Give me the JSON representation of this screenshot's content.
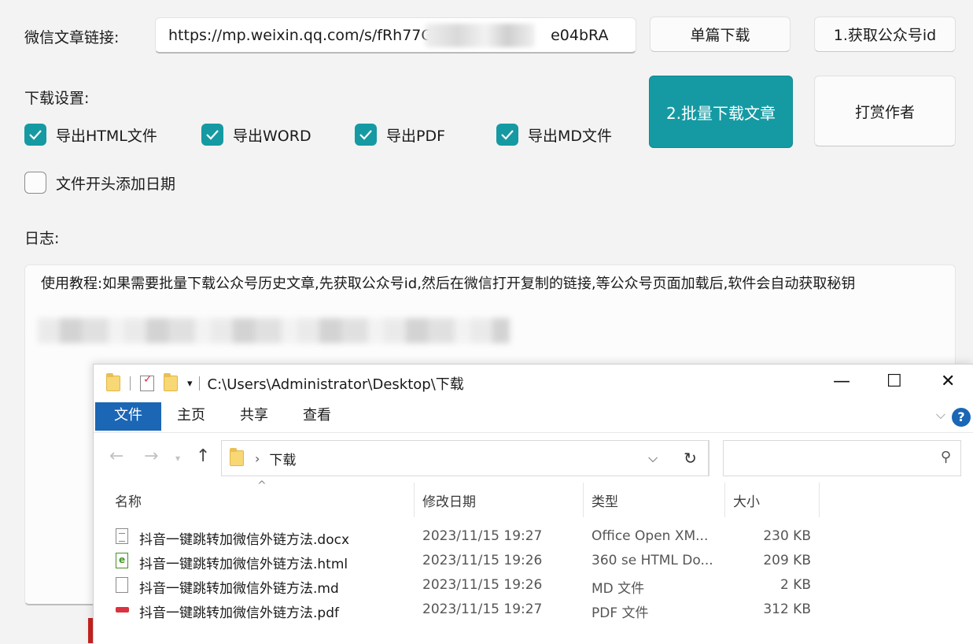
{
  "app": {
    "url_label": "微信文章链接:",
    "url_value": "https://mp.weixin.qq.com/s/fRh77G",
    "url_value_tail": "e04bRA",
    "single_download": "单篇下载",
    "get_account_id": "1.获取公众号id",
    "settings_label": "下载设置:",
    "batch_download": "2.批量下载文章",
    "tip_author": "打赏作者",
    "options": [
      {
        "label": "导出HTML文件",
        "checked": true
      },
      {
        "label": "导出WORD",
        "checked": true
      },
      {
        "label": "导出PDF",
        "checked": true
      },
      {
        "label": "导出MD文件",
        "checked": true
      }
    ],
    "date_prefix": {
      "label": "文件开头添加日期",
      "checked": false
    },
    "log_label": "日志:",
    "log_text": "使用教程:如果需要批量下载公众号历史文章,先获取公众号id,然后在微信打开复制的链接,等公众号页面加载后,软件会自动获取秘钥"
  },
  "explorer": {
    "title": "C:\\Users\\Administrator\\Desktop\\下载",
    "window_controls": {
      "minimize": "—",
      "maximize": "☐",
      "close": "✕"
    },
    "ribbon_tabs": [
      "文件",
      "主页",
      "共享",
      "查看"
    ],
    "breadcrumb": "下载",
    "columns": {
      "name": "名称",
      "modified": "修改日期",
      "type": "类型",
      "size": "大小"
    },
    "files": [
      {
        "name": "抖音一键跳转加微信外链方法.docx",
        "modified": "2023/11/15 19:27",
        "type": "Office Open XM...",
        "size": "230 KB",
        "icon": "doc"
      },
      {
        "name": "抖音一键跳转加微信外链方法.html",
        "modified": "2023/11/15 19:26",
        "type": "360 se HTML Do...",
        "size": "209 KB",
        "icon": "html"
      },
      {
        "name": "抖音一键跳转加微信外链方法.md",
        "modified": "2023/11/15 19:26",
        "type": "MD 文件",
        "size": "2 KB",
        "icon": "md"
      },
      {
        "name": "抖音一键跳转加微信外链方法.pdf",
        "modified": "2023/11/15 19:27",
        "type": "PDF 文件",
        "size": "312 KB",
        "icon": "pdf"
      }
    ]
  },
  "colors": {
    "accent": "#159aa3",
    "explorer_accent": "#1b66b5"
  }
}
